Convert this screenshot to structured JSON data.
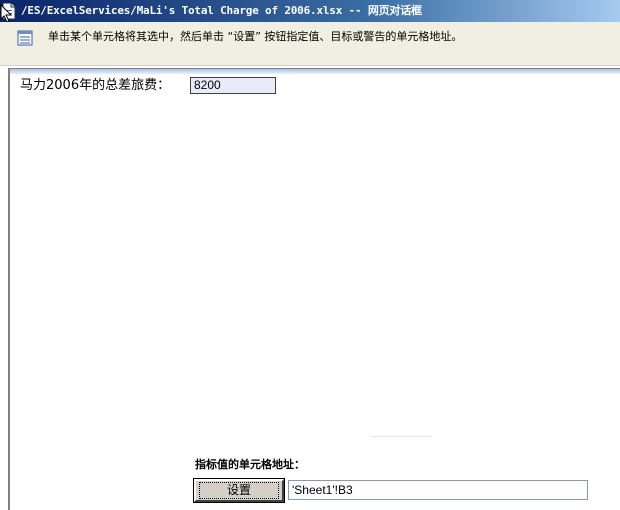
{
  "window": {
    "title": "/ES/ExcelServices/MaLi's Total Charge of 2006.xlsx -- 网页对话框"
  },
  "infobar": {
    "text": "单击某个单元格将其选中，然后单击 “设置” 按钮指定值、目标或警告的单元格地址。"
  },
  "sheet": {
    "label": "马力2006年的总差旅费：",
    "value": "8200"
  },
  "target": {
    "label": "指标值的单元格地址：",
    "button_label": "设置",
    "address_value": "'Sheet1'!B3"
  },
  "colors": {
    "titlebar_start": "#0a246a",
    "titlebar_end": "#a6caf0",
    "infobar_bg": "#f1efe2",
    "cell_value_bg": "#eaeaf8"
  }
}
